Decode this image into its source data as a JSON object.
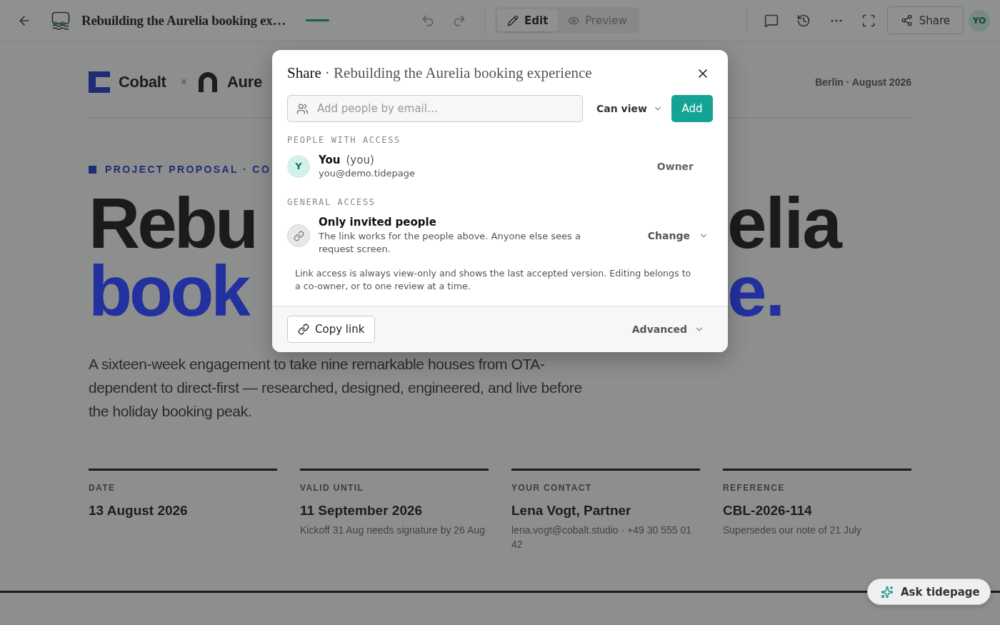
{
  "topbar": {
    "title": "Rebuilding the Aurelia booking ex…",
    "modes": [
      {
        "label": "Edit",
        "selected": true
      },
      {
        "label": "Preview",
        "selected": false
      }
    ],
    "share": "Share",
    "avatar": "YO"
  },
  "document": {
    "brand": {
      "left": "Cobalt",
      "separator": "×",
      "right": "Aure"
    },
    "place_date": "Berlin · August 2026",
    "eyebrow": "PROJECT PROPOSAL · CO",
    "headline": [
      {
        "left": "Rebu",
        "right": "elia",
        "color": "#1a1c1c"
      },
      {
        "left": "book",
        "right": "e.",
        "color": "#23309f"
      }
    ],
    "lede": "A sixteen-week engagement to take nine remarkable houses from OTA-dependent to direct-first — researched, designed, engineered, and live before the holiday booking peak.",
    "facts": [
      {
        "label": "DATE",
        "value": "13 August 2026"
      },
      {
        "label": "VALID UNTIL",
        "value": "11 September 2026",
        "note": "Kickoff 31 Aug needs signature by 26 Aug"
      },
      {
        "label": "YOUR CONTACT",
        "value": "Lena Vogt, Partner",
        "note": "lena.vogt@cobalt.studio · +49 30 555 01 42"
      },
      {
        "label": "REFERENCE",
        "value": "CBL-2026-114",
        "note": "Supersedes our note of 21 July"
      }
    ]
  },
  "assistant": {
    "label": "Ask tidepage"
  },
  "dialog": {
    "title": "Share",
    "subtitle": "· Rebuilding the Aurelia booking experience",
    "email_placeholder": "Add people by email…",
    "role": "Can view",
    "add": "Add",
    "people_heading": "PEOPLE WITH ACCESS",
    "people": [
      {
        "initial": "Y",
        "name": "You",
        "tag": "(you)",
        "email": "you@demo.tidepage",
        "role": "Owner"
      }
    ],
    "general_heading": "GENERAL ACCESS",
    "general": {
      "title": "Only invited people",
      "description": "The link works for the people above. Anyone else sees a request screen.",
      "action": "Change"
    },
    "note": "Link access is always view-only and shows the last accepted version. Editing belongs to a co-owner, or to one review at a time.",
    "copy_link": "Copy link",
    "advanced": "Advanced"
  }
}
